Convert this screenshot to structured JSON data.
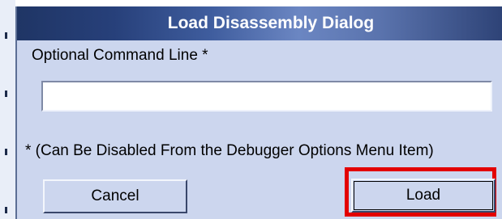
{
  "dialog": {
    "title": "Load Disassembly Dialog",
    "command_line_label": "Optional Command Line *",
    "command_line_value": "",
    "note": "* (Can Be Disabled From the Debugger Options Menu Item)",
    "cancel_label": "Cancel",
    "load_label": "Load"
  },
  "colors": {
    "dialog_background": "#ccd6ee",
    "titlebar_dark": "#1f3565",
    "titlebar_light": "#6b86c2",
    "highlight": "#e30000"
  }
}
